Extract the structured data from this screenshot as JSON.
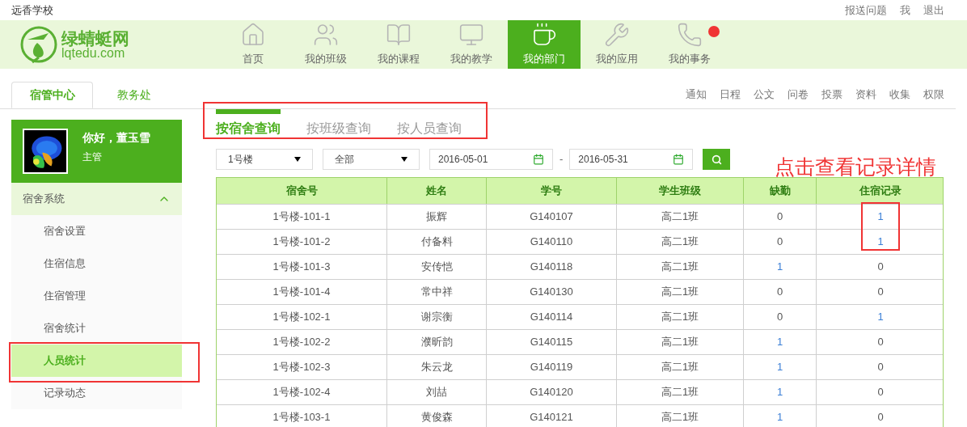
{
  "school": "远香学校",
  "top_links": [
    "报送问题",
    "我",
    "退出"
  ],
  "logo": {
    "name": "绿蜻蜓网",
    "domain": "lqtedu.com"
  },
  "nav": [
    {
      "label": "首页",
      "selected": false,
      "badge": false
    },
    {
      "label": "我的班级",
      "selected": false,
      "badge": false
    },
    {
      "label": "我的课程",
      "selected": false,
      "badge": false
    },
    {
      "label": "我的教学",
      "selected": false,
      "badge": false
    },
    {
      "label": "我的部门",
      "selected": true,
      "badge": false
    },
    {
      "label": "我的应用",
      "selected": false,
      "badge": false
    },
    {
      "label": "我的事务",
      "selected": false,
      "badge": true
    }
  ],
  "dept_tabs": [
    {
      "label": "宿管中心",
      "selected": true
    },
    {
      "label": "教务处",
      "selected": false
    }
  ],
  "tool_links": [
    "通知",
    "日程",
    "公文",
    "问卷",
    "投票",
    "资料",
    "收集",
    "权限"
  ],
  "profile": {
    "greeting": "你好，董玉雪",
    "role": "主管"
  },
  "sidebar": {
    "section": {
      "label": "宿舍系统",
      "expanded": true
    },
    "items": [
      {
        "label": "宿舍设置",
        "selected": false
      },
      {
        "label": "住宿信息",
        "selected": false
      },
      {
        "label": "住宿管理",
        "selected": false
      },
      {
        "label": "宿舍统计",
        "selected": false
      },
      {
        "label": "人员统计",
        "selected": true
      },
      {
        "label": "记录动态",
        "selected": false
      }
    ]
  },
  "query_tabs": [
    {
      "label": "按宿舍查询",
      "selected": true
    },
    {
      "label": "按班级查询",
      "selected": false
    },
    {
      "label": "按人员查询",
      "selected": false
    }
  ],
  "filters": {
    "building": "1号楼",
    "scope": "全部",
    "date_from": "2016-05-01",
    "separator": "-",
    "date_to": "2016-05-31"
  },
  "annotation": "点击查看记录详情",
  "table": {
    "columns": [
      "宿舍号",
      "姓名",
      "学号",
      "学生班级",
      "缺勤",
      "住宿记录"
    ],
    "rows": [
      {
        "room": "1号楼-101-1",
        "name": "振辉",
        "id": "G140107",
        "class": "高二1班",
        "absence": {
          "text": "0",
          "link": false
        },
        "records": {
          "text": "1",
          "link": true
        }
      },
      {
        "room": "1号楼-101-2",
        "name": "付备料",
        "id": "G140110",
        "class": "高二1班",
        "absence": {
          "text": "0",
          "link": false
        },
        "records": {
          "text": "1",
          "link": true
        }
      },
      {
        "room": "1号楼-101-3",
        "name": "安传恺",
        "id": "G140118",
        "class": "高二1班",
        "absence": {
          "text": "1",
          "link": true
        },
        "records": {
          "text": "0",
          "link": false
        }
      },
      {
        "room": "1号楼-101-4",
        "name": "常中祥",
        "id": "G140130",
        "class": "高二1班",
        "absence": {
          "text": "0",
          "link": false
        },
        "records": {
          "text": "0",
          "link": false
        }
      },
      {
        "room": "1号楼-102-1",
        "name": "谢宗衡",
        "id": "G140114",
        "class": "高二1班",
        "absence": {
          "text": "0",
          "link": false
        },
        "records": {
          "text": "1",
          "link": true
        }
      },
      {
        "room": "1号楼-102-2",
        "name": "濮昕韵",
        "id": "G140115",
        "class": "高二1班",
        "absence": {
          "text": "1",
          "link": true
        },
        "records": {
          "text": "0",
          "link": false
        }
      },
      {
        "room": "1号楼-102-3",
        "name": "朱云龙",
        "id": "G140119",
        "class": "高二1班",
        "absence": {
          "text": "1",
          "link": true
        },
        "records": {
          "text": "0",
          "link": false
        }
      },
      {
        "room": "1号楼-102-4",
        "name": "刘喆",
        "id": "G140120",
        "class": "高二1班",
        "absence": {
          "text": "1",
          "link": true
        },
        "records": {
          "text": "0",
          "link": false
        }
      },
      {
        "room": "1号楼-103-1",
        "name": "黄俊森",
        "id": "G140121",
        "class": "高二1班",
        "absence": {
          "text": "1",
          "link": true
        },
        "records": {
          "text": "0",
          "link": false
        }
      }
    ]
  }
}
